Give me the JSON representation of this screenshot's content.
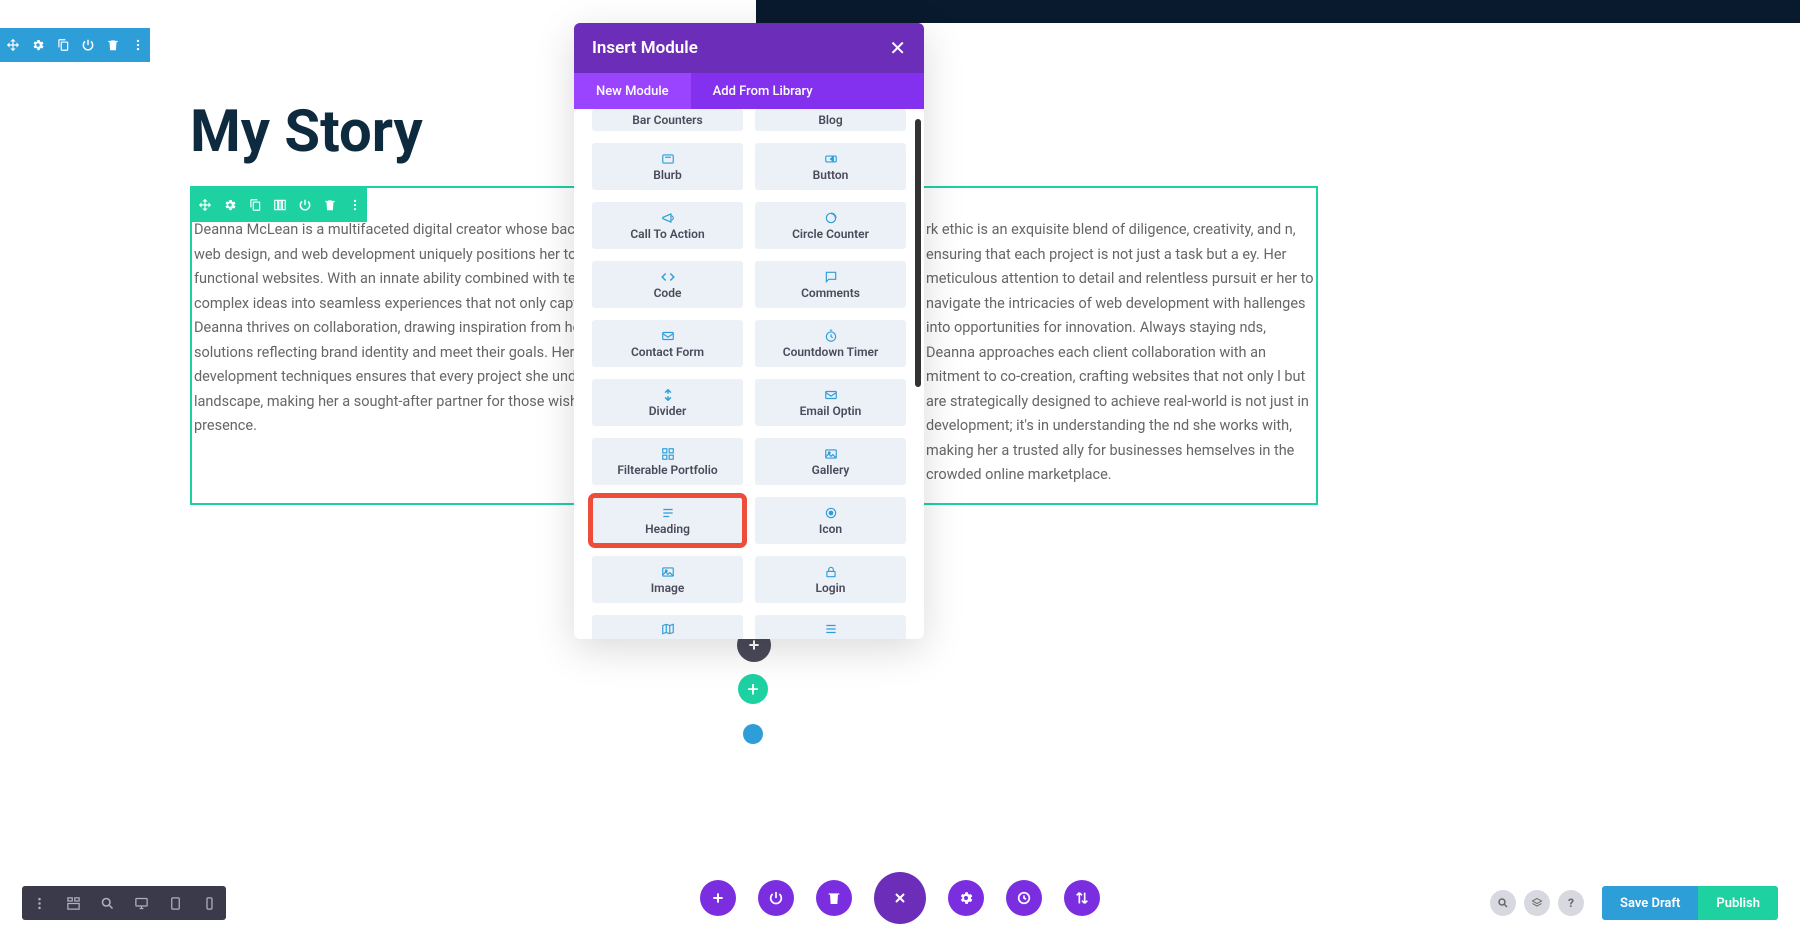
{
  "page": {
    "title": "My Story",
    "text_left": "Deanna McLean is a multifaceted digital creator whose background in graphic design, web design, and web development uniquely positions her to craft stunning and highly functional websites. With an innate ability combined with technology, she transforms complex ideas into seamless experiences that not only captivate but also convert. Deanna thrives on collaboration, drawing inspiration from her clients to create tailored solutions reflecting brand identity and meet their goals. Her expertise in the latest development techniques ensures that every project she undertakes lives in the digital landscape, making her a sought-after partner for those wishing to elevate their online presence.",
    "text_right": "rk ethic is an exquisite blend of diligence, creativity, and n, ensuring that each project is not just a task but a ey. Her meticulous attention to detail and relentless pursuit er her to navigate the intricacies of web development with hallenges into opportunities for innovation. Always staying nds, Deanna approaches each client collaboration with an mitment to co-creation, crafting websites that not only l but are strategically designed to achieve real-world is not just in development; it's in understanding the nd she works with, making her a trusted ally for businesses hemselves in the crowded online marketplace."
  },
  "modal": {
    "title": "Insert Module",
    "tabs": {
      "new": "New Module",
      "library": "Add From Library"
    },
    "modules": {
      "bar_counters": "Bar Counters",
      "blog": "Blog",
      "blurb": "Blurb",
      "button": "Button",
      "cta": "Call To Action",
      "circle_counter": "Circle Counter",
      "code": "Code",
      "comments": "Comments",
      "contact_form": "Contact Form",
      "countdown_timer": "Countdown Timer",
      "divider": "Divider",
      "email_optin": "Email Optin",
      "filterable_portfolio": "Filterable Portfolio",
      "gallery": "Gallery",
      "heading": "Heading",
      "icon": "Icon",
      "image": "Image",
      "login": "Login"
    }
  },
  "bottom": {
    "save_draft": "Save Draft",
    "publish": "Publish"
  }
}
